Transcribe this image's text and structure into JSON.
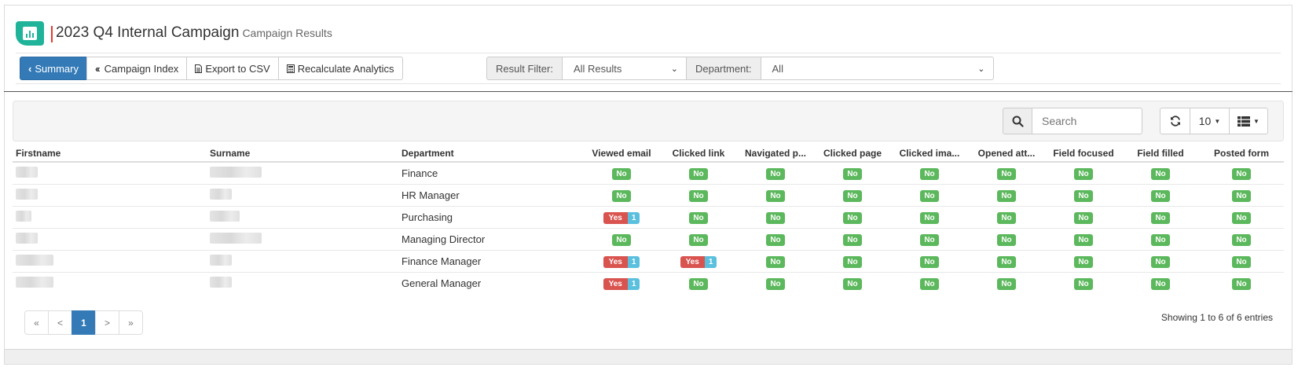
{
  "header": {
    "title": "2023 Q4 Internal Campaign",
    "subtitle": "Campaign Results",
    "accent_color": "#1fb39a"
  },
  "toolbar": {
    "summary_label": "Summary",
    "campaign_index_label": "Campaign Index",
    "export_label": "Export to CSV",
    "recalc_label": "Recalculate Analytics"
  },
  "filters": {
    "result_label": "Result Filter:",
    "result_value": "All Results",
    "department_label": "Department:",
    "department_value": "All"
  },
  "table_tools": {
    "search_placeholder": "Search",
    "page_size": "10"
  },
  "table": {
    "headers": [
      "Firstname",
      "Surname",
      "Department",
      "Viewed email",
      "Clicked link",
      "Navigated p...",
      "Clicked page",
      "Clicked ima...",
      "Opened att...",
      "Field focused",
      "Field filled",
      "Posted form"
    ],
    "rows": [
      {
        "department": "Finance",
        "cells": [
          [
            "No"
          ],
          [
            "No"
          ],
          [
            "No"
          ],
          [
            "No"
          ],
          [
            "No"
          ],
          [
            "No"
          ],
          [
            "No"
          ],
          [
            "No"
          ],
          [
            "No"
          ]
        ]
      },
      {
        "department": "HR Manager",
        "cells": [
          [
            "No"
          ],
          [
            "No"
          ],
          [
            "No"
          ],
          [
            "No"
          ],
          [
            "No"
          ],
          [
            "No"
          ],
          [
            "No"
          ],
          [
            "No"
          ],
          [
            "No"
          ]
        ]
      },
      {
        "department": "Purchasing",
        "cells": [
          [
            "Yes",
            "1"
          ],
          [
            "No"
          ],
          [
            "No"
          ],
          [
            "No"
          ],
          [
            "No"
          ],
          [
            "No"
          ],
          [
            "No"
          ],
          [
            "No"
          ],
          [
            "No"
          ]
        ]
      },
      {
        "department": "Managing Director",
        "cells": [
          [
            "No"
          ],
          [
            "No"
          ],
          [
            "No"
          ],
          [
            "No"
          ],
          [
            "No"
          ],
          [
            "No"
          ],
          [
            "No"
          ],
          [
            "No"
          ],
          [
            "No"
          ]
        ]
      },
      {
        "department": "Finance Manager",
        "cells": [
          [
            "Yes",
            "1"
          ],
          [
            "Yes",
            "1"
          ],
          [
            "No"
          ],
          [
            "No"
          ],
          [
            "No"
          ],
          [
            "No"
          ],
          [
            "No"
          ],
          [
            "No"
          ],
          [
            "No"
          ]
        ]
      },
      {
        "department": "General Manager",
        "cells": [
          [
            "Yes",
            "1"
          ],
          [
            "No"
          ],
          [
            "No"
          ],
          [
            "No"
          ],
          [
            "No"
          ],
          [
            "No"
          ],
          [
            "No"
          ],
          [
            "No"
          ],
          [
            "No"
          ]
        ]
      }
    ]
  },
  "pagination": {
    "first": "«",
    "prev": "<",
    "current": "1",
    "next": ">",
    "last": "»",
    "summary": "Showing 1 to 6 of 6 entries"
  },
  "colors": {
    "primary": "#337ab7",
    "no_label": "#5cb85c",
    "yes_label": "#d9534f",
    "count_label": "#5bc0de"
  }
}
